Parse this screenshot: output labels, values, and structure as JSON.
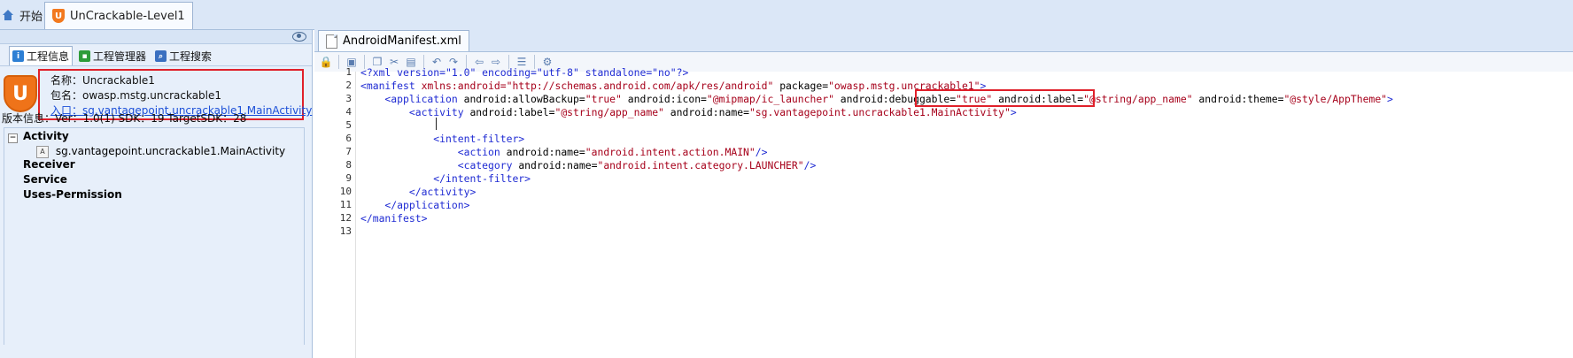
{
  "top_tabs": {
    "home": "开始",
    "project": "UnCrackable-Level1"
  },
  "left_panel": {
    "tabs": [
      "工程信息",
      "工程管理器",
      "工程搜索"
    ],
    "info": {
      "name": "名称：Uncrackable1",
      "package": "包名：owasp.mstg.uncrackable1",
      "entry": "入口：sg.vantagepoint.uncrackable1.MainActivity"
    },
    "version": "版本信息：Ver：1.0(1) SDK：19 TargetSDK：28",
    "tree": {
      "activity": "Activity",
      "activity_item": "sg.vantagepoint.uncrackable1.MainActivity",
      "receiver": "Receiver",
      "service": "Service",
      "uses_permission": "Uses-Permission"
    }
  },
  "editor": {
    "tab": "AndroidManifest.xml",
    "line_numbers": [
      "1",
      "2",
      "3",
      "4",
      "5",
      "6",
      "7",
      "8",
      "9",
      "10",
      "11",
      "12",
      "13"
    ],
    "code": {
      "l1": "<?xml version=\"1.0\" encoding=\"utf-8\" standalone=\"no\"?>",
      "l2a": "<manifest ",
      "l2b": "xmlns:android=",
      "l2c": "\"http://schemas.android.com/apk/res/android\"",
      "l2d": " package=",
      "l2e": "\"owasp.mstg.uncrackable1\"",
      "l2f": ">",
      "l3a": "    <application ",
      "l3b": "android:allowBackup=",
      "l3c": "\"true\"",
      "l3d": " android:icon=",
      "l3e": "\"@mipmap/ic_launcher\"",
      "l3f": " android:debuggable=",
      "l3g": "\"true\"",
      "l3h": " android:label=",
      "l3i": "\"@string/app_name\"",
      "l3j": " android:theme=",
      "l3k": "\"@style/AppTheme\"",
      "l3l": ">",
      "l4a": "        <activity ",
      "l4b": "android:label=",
      "l4c": "\"@string/app_name\"",
      "l4d": " android:name=",
      "l4e": "\"sg.vantagepoint.uncrackable1.MainActivity\"",
      "l4f": ">",
      "l6": "            <intent-filter>",
      "l7a": "                <action ",
      "l7b": "android:name=",
      "l7c": "\"android.intent.action.MAIN\"",
      "l7d": "/>",
      "l8a": "                <category ",
      "l8b": "android:name=",
      "l8c": "\"android.intent.category.LAUNCHER\"",
      "l8d": "/>",
      "l9": "            </intent-filter>",
      "l10": "        </activity>",
      "l11": "    </application>",
      "l12": "</manifest>"
    }
  },
  "colors": {
    "highlight": "#e0202a",
    "tag": "#1f2bd3",
    "value": "#a6001a",
    "accent": "#ef7319"
  }
}
